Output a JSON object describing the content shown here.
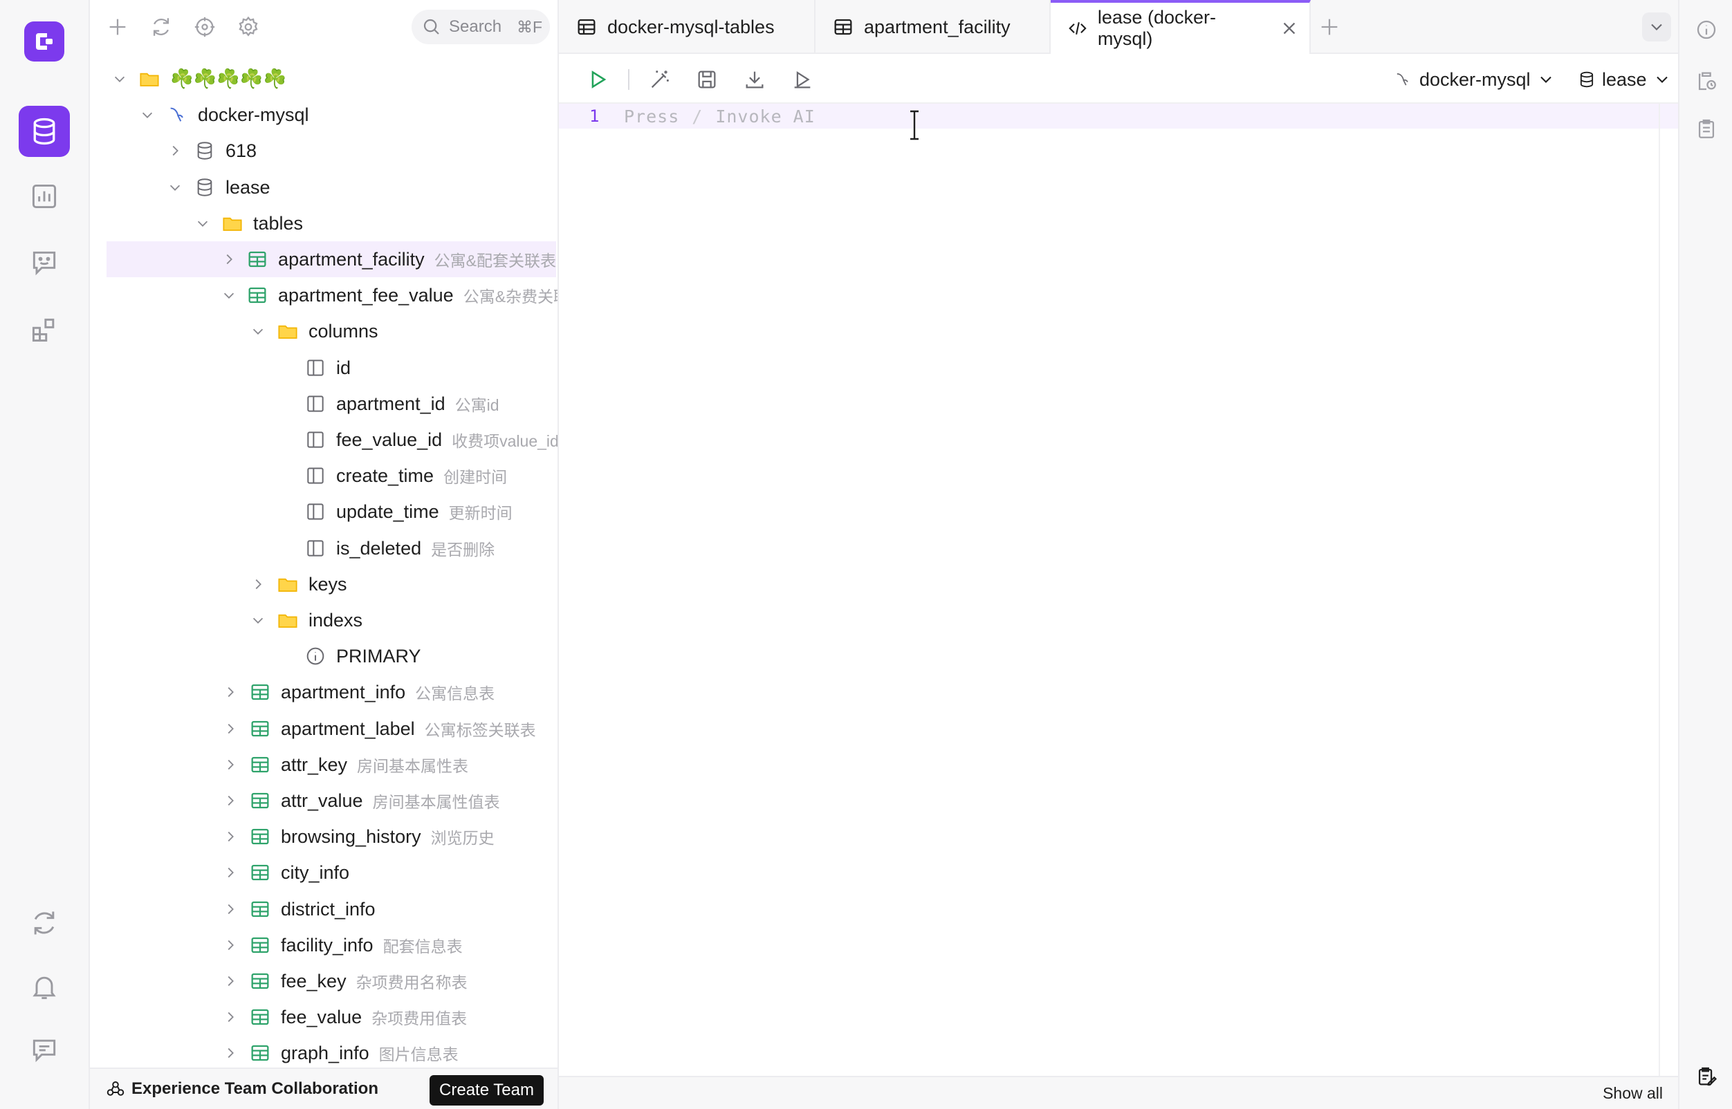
{
  "sidebar": {
    "search": {
      "placeholder": "Search",
      "shortcut": "⌘F"
    },
    "tree": [
      {
        "label": "☘️☘️☘️☘️☘️",
        "icon": "folder-icon"
      },
      {
        "label": "docker-mysql",
        "icon": "mysql-dolphin-icon"
      },
      {
        "label": "618",
        "icon": "database-icon"
      },
      {
        "label": "lease",
        "icon": "database-icon"
      },
      {
        "label": "tables",
        "icon": "folder-icon"
      },
      {
        "label": "apartment_facility",
        "comment": "公寓&配套关联表",
        "icon": "table-icon"
      },
      {
        "label": "apartment_fee_value",
        "comment": "公寓&杂费关联表",
        "icon": "table-icon"
      },
      {
        "label": "columns",
        "icon": "folder-icon"
      },
      {
        "label": "id",
        "icon": "column-icon"
      },
      {
        "label": "apartment_id",
        "comment": "公寓id",
        "icon": "column-icon"
      },
      {
        "label": "fee_value_id",
        "comment": "收费项value_id",
        "icon": "column-icon"
      },
      {
        "label": "create_time",
        "comment": "创建时间",
        "icon": "column-icon"
      },
      {
        "label": "update_time",
        "comment": "更新时间",
        "icon": "column-icon"
      },
      {
        "label": "is_deleted",
        "comment": "是否删除",
        "icon": "column-icon"
      },
      {
        "label": "keys",
        "icon": "folder-icon"
      },
      {
        "label": "indexs",
        "icon": "folder-icon"
      },
      {
        "label": "PRIMARY",
        "icon": "index-icon"
      },
      {
        "label": "apartment_info",
        "comment": "公寓信息表",
        "icon": "table-icon"
      },
      {
        "label": "apartment_label",
        "comment": "公寓标签关联表",
        "icon": "table-icon"
      },
      {
        "label": "attr_key",
        "comment": "房间基本属性表",
        "icon": "table-icon"
      },
      {
        "label": "attr_value",
        "comment": "房间基本属性值表",
        "icon": "table-icon"
      },
      {
        "label": "browsing_history",
        "comment": "浏览历史",
        "icon": "table-icon"
      },
      {
        "label": "city_info",
        "icon": "table-icon"
      },
      {
        "label": "district_info",
        "icon": "table-icon"
      },
      {
        "label": "facility_info",
        "comment": "配套信息表",
        "icon": "table-icon"
      },
      {
        "label": "fee_key",
        "comment": "杂项费用名称表",
        "icon": "table-icon"
      },
      {
        "label": "fee_value",
        "comment": "杂项费用值表",
        "icon": "table-icon"
      },
      {
        "label": "graph_info",
        "comment": "图片信息表",
        "icon": "table-icon"
      }
    ],
    "collab": {
      "text": "Experience Team Collaboration",
      "button": "Create Team"
    }
  },
  "tabs": [
    {
      "label": "docker-mysql-tables",
      "icon": "table-list-icon"
    },
    {
      "label": "apartment_facility",
      "icon": "table-icon"
    },
    {
      "label": "lease (docker-mysql)",
      "icon": "code-icon",
      "active": true
    }
  ],
  "toolbar": {
    "connection": "docker-mysql",
    "database": "lease"
  },
  "editor": {
    "line_number": "1",
    "placeholder_press": "Press",
    "placeholder_slash": "/",
    "placeholder_invoke": "Invoke AI"
  },
  "status": {
    "show_all": "Show all"
  },
  "colors": {
    "accent": "#7c3aed",
    "table_green": "#2fa36b",
    "folder_yellow": "#f5b800",
    "run_green": "#22a35a"
  }
}
